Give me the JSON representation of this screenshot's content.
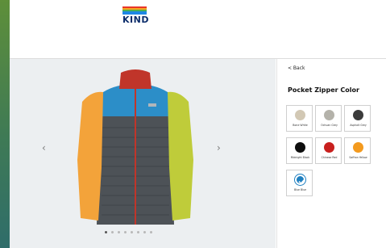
{
  "brand": {
    "logo_text": "KIND",
    "logo_colors": [
      "#e8362a",
      "#f7a521",
      "#4caf50",
      "#1e88e5"
    ]
  },
  "gallery": {
    "prev_arrow": "‹",
    "next_arrow": "›",
    "dot_count": 8,
    "active_dot": 0
  },
  "panel": {
    "back_label": "< Back",
    "title": "Pocket Zipper Color",
    "swatches": [
      {
        "label": "Bone White",
        "color": "#d2c8b4"
      },
      {
        "label": "Ochuan Grey",
        "color": "#b4b2aa"
      },
      {
        "label": "Asphalt Grey",
        "color": "#3b3b3b"
      },
      {
        "label": "Midnight Black",
        "color": "#0e0e0e"
      },
      {
        "label": "Chinese Red",
        "color": "#c8201e"
      },
      {
        "label": "Saffron Yellow",
        "color": "#f39a1e"
      },
      {
        "label": "Blue Blue",
        "color": "#1e7fc0"
      }
    ],
    "selected_swatch": 6
  },
  "jacket_colors": {
    "collar": "#c0352a",
    "shoulders": "#2c8ec8",
    "body": "#4d5257",
    "left_sleeve": "#f3a33a",
    "right_sleeve": "#bfcc3a",
    "zipper": "#c0352a"
  }
}
